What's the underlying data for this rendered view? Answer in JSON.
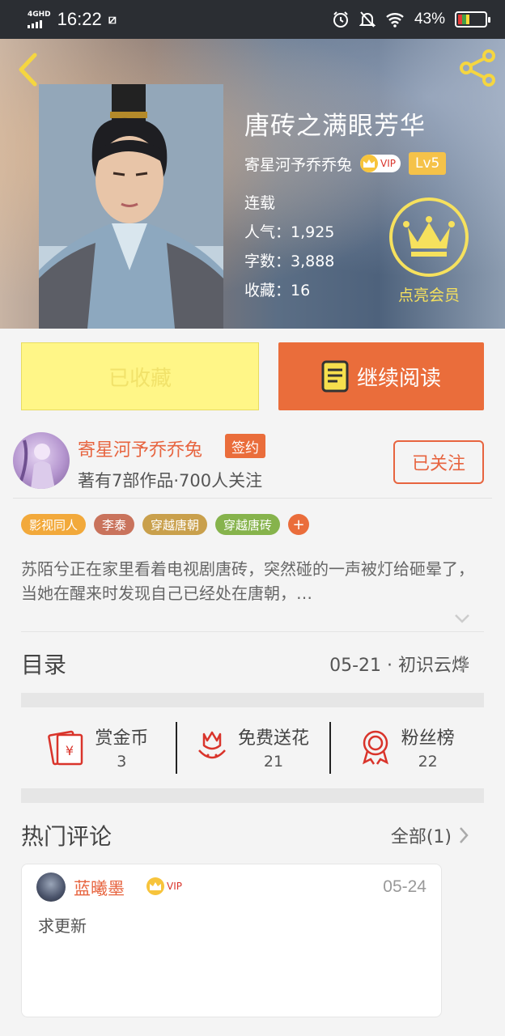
{
  "status_bar": {
    "network": "4GHD",
    "time": "16:22",
    "battery_pct": "43%",
    "battery_level": 0.43
  },
  "book": {
    "title": "唐砖之满眼芳华",
    "author": "寄星河予乔乔兔",
    "vip_label": "VIP",
    "level": "Lv5",
    "status": "连载",
    "popularity": "人气：1,925",
    "word_count": "字数：3,888",
    "favorites": "收藏：16",
    "member_label": "点亮会员"
  },
  "actions": {
    "favorited_label": "已收藏",
    "continue_label": "继续阅读"
  },
  "author_info": {
    "name": "寄星河予乔乔兔",
    "sign_badge": "签约",
    "meta": "著有7部作品·700人关注",
    "follow_label": "已关注"
  },
  "tags": [
    {
      "label": "影视同人",
      "color": "#f2a93b"
    },
    {
      "label": "李泰",
      "color": "#c9735c"
    },
    {
      "label": "穿越唐朝",
      "color": "#c9a04c"
    },
    {
      "label": "穿越唐砖",
      "color": "#86b34c"
    }
  ],
  "tag_more": "+",
  "synopsis": "苏陌兮正在家里看着电视剧唐砖，突然碰的一声被灯给砸晕了，当她在醒来时发现自己已经处在唐朝，…",
  "catalog": {
    "label": "目录",
    "latest": "05-21 · 初识云烨"
  },
  "support": [
    {
      "label": "赏金币",
      "count": "3"
    },
    {
      "label": "免费送花",
      "count": "21"
    },
    {
      "label": "粉丝榜",
      "count": "22"
    }
  ],
  "comments": {
    "title": "热门评论",
    "all_label": "全部(1)",
    "items": [
      {
        "user": "蓝曦墨",
        "vip_label": "VIP",
        "date": "05-24",
        "text": "求更新"
      }
    ]
  },
  "colors": {
    "accent": "#ea6d3b",
    "favorite_bg": "#fff687",
    "member_gold": "#f6e15d"
  }
}
